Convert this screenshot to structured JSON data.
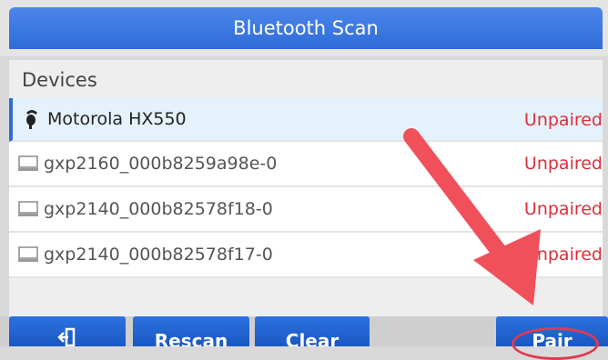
{
  "window": {
    "title": "Bluetooth Scan"
  },
  "devices_section": {
    "label": "Devices"
  },
  "devices": [
    {
      "name": "Motorola HX550",
      "status": "Unpaired",
      "icon": "headset-icon",
      "selected": true
    },
    {
      "name": "gxp2160_000b8259a98e-0",
      "status": "Unpaired",
      "icon": "phone-device-icon",
      "selected": false
    },
    {
      "name": "gxp2140_000b82578f18-0",
      "status": "Unpaired",
      "icon": "phone-device-icon",
      "selected": false
    },
    {
      "name": "gxp2140_000b82578f17-0",
      "status": "Unpaired",
      "icon": "phone-device-icon",
      "selected": false
    }
  ],
  "softkeys": {
    "back_icon": "back-exit-icon",
    "rescan": "Rescan",
    "clear": "Clear",
    "pair": "Pair"
  },
  "colors": {
    "title_bar": "#3b79e3",
    "status_unpaired": "#d9303a",
    "annotation": "#f0505a"
  }
}
